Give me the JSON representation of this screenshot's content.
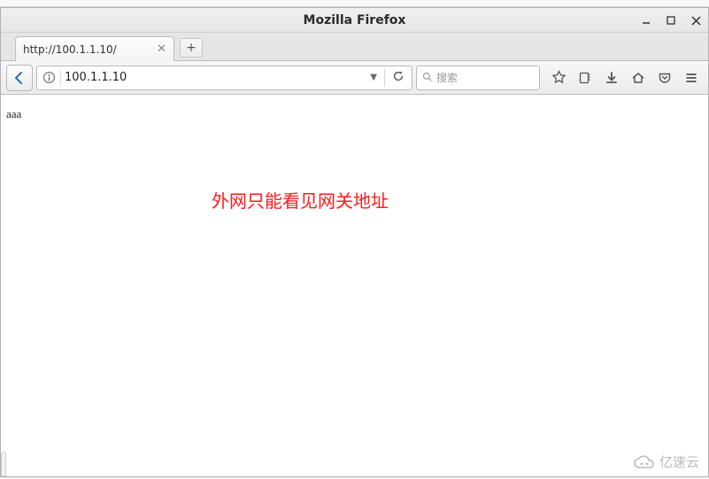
{
  "window": {
    "title": "Mozilla Firefox"
  },
  "tab": {
    "label": "http://100.1.1.10/"
  },
  "urlbar": {
    "value": "100.1.1.10"
  },
  "searchbar": {
    "placeholder": "搜索"
  },
  "page": {
    "small_text": "aaa",
    "main_text": "外网只能看见网关地址"
  },
  "watermark": {
    "text": "亿速云"
  }
}
